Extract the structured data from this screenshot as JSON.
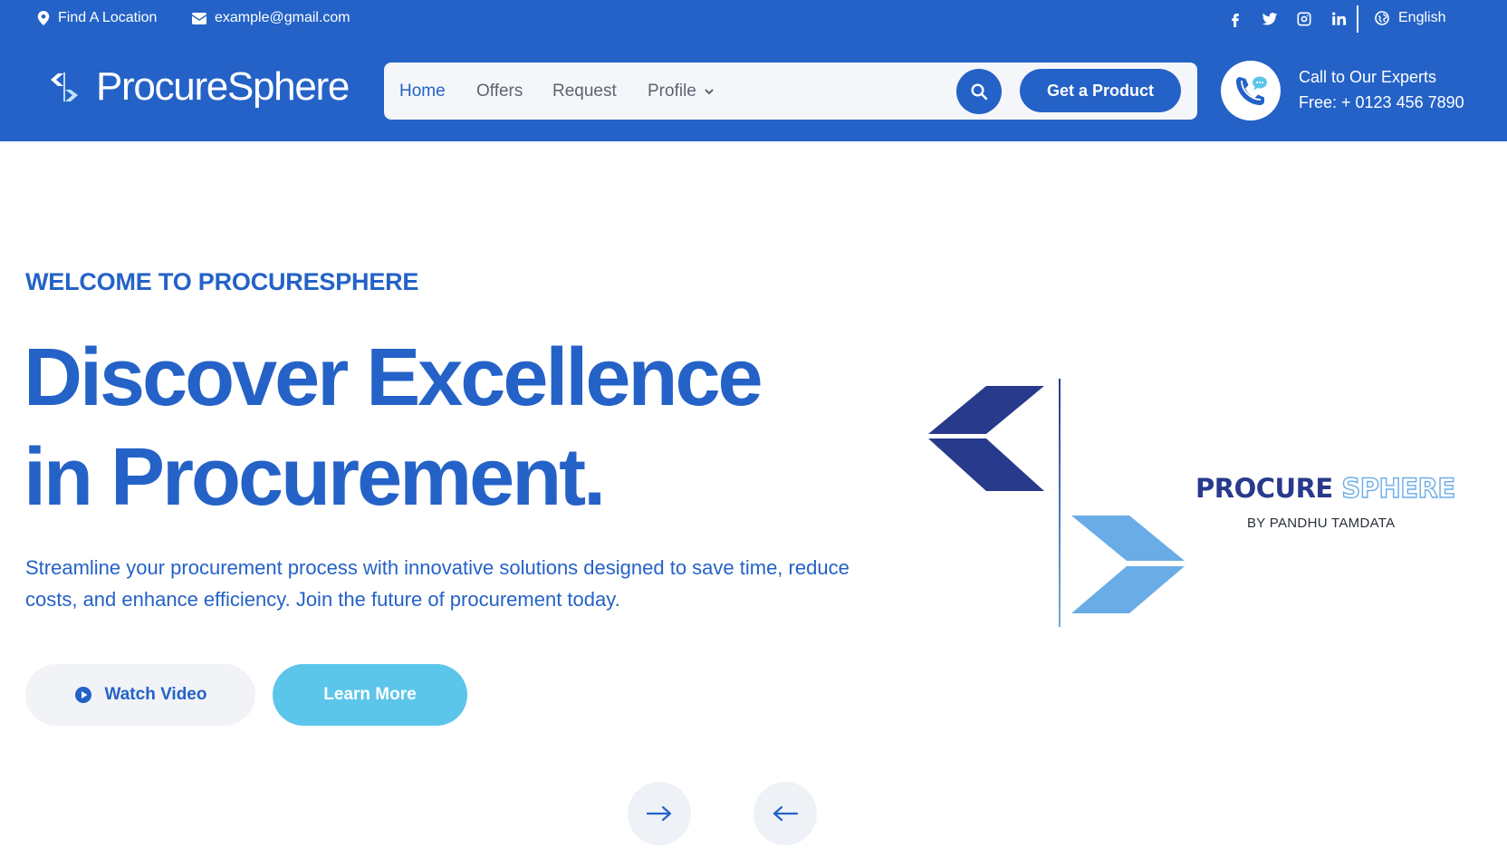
{
  "topbar": {
    "location_label": "Find A Location",
    "email_label": "example@gmail.com",
    "socials": [
      "facebook-icon",
      "twitter-icon",
      "instagram-icon",
      "linkedin-icon"
    ],
    "language_label": "English"
  },
  "header": {
    "brand_name": "ProcureSphere",
    "nav": [
      {
        "label": "Home",
        "active": true
      },
      {
        "label": "Offers",
        "active": false
      },
      {
        "label": "Request",
        "active": false
      },
      {
        "label": "Profile",
        "has_dropdown": true
      }
    ],
    "cta_label": "Get a Product",
    "call_line1": "Call to Our Experts",
    "call_line2": "Free: + 0123 456 7890"
  },
  "hero": {
    "eyebrow": "WELCOME TO PROCURESPHERE",
    "headline_line1": "Discover Excellence",
    "headline_line2": "in Procurement.",
    "lead": "Streamline your procurement process with innovative solutions designed to save time, reduce costs, and enhance efficiency. Join the future of procurement today.",
    "watch_label": "Watch Video",
    "learn_label": "Learn More",
    "logo_word1": "PROCURE",
    "logo_word2": "SPHERE",
    "logo_sub": "BY PANDHU TAMDATA"
  },
  "colors": {
    "primary": "#2462c7",
    "accent": "#5cc5ea",
    "logo_dark": "#283a8c",
    "logo_light": "#6aace6"
  }
}
